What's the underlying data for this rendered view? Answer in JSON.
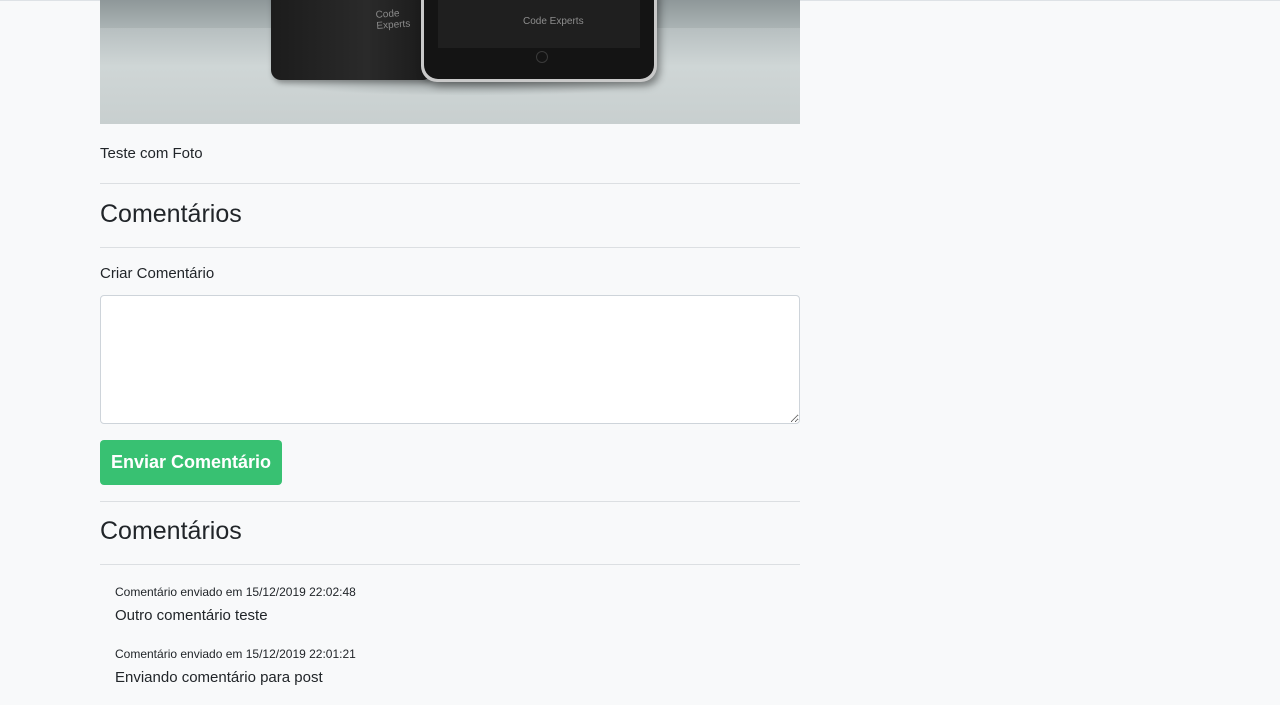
{
  "post": {
    "image_brand_back": "Code Experts",
    "image_brand_front": "Code Experts",
    "text": "Teste com Foto"
  },
  "comments_section": {
    "heading": "Comentários"
  },
  "form": {
    "label": "Criar Comentário",
    "textarea_value": "",
    "submit_label": "Enviar Comentário"
  },
  "comments_list": {
    "heading": "Comentários",
    "items": [
      {
        "meta": "Comentário enviado em 15/12/2019 22:02:48",
        "body": "Outro comentário teste"
      },
      {
        "meta": "Comentário enviado em 15/12/2019 22:01:21",
        "body": "Enviando comentário para post"
      }
    ]
  },
  "colors": {
    "page_background": "#f8f9fa",
    "primary_button": "#38c172",
    "text": "#212529"
  }
}
